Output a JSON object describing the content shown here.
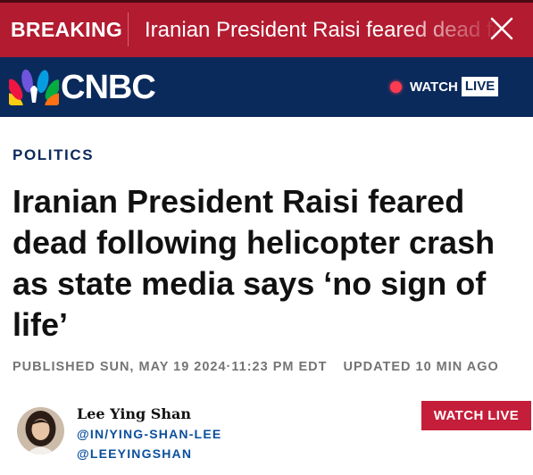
{
  "breaking": {
    "label": "BREAKING",
    "headline": "Iranian President Raisi feared dead following helicopter crash",
    "close_icon": "close-icon"
  },
  "nav": {
    "logo_text": "CNBC",
    "logo_icon": "peacock-icon",
    "watch_label": "WATCH",
    "live_label": "LIVE"
  },
  "article": {
    "section": "POLITICS",
    "headline": "Iranian President Raisi feared dead following helicopter crash as state media says ‘no sign of life’",
    "published": "PUBLISHED SUN, MAY 19 2024·11:23 PM EDT",
    "updated": "UPDATED 10 MIN AGO"
  },
  "author": {
    "name": "Lee Ying Shan",
    "handles": [
      "@IN/YING-SHAN-LEE",
      "@LEEYINGSHAN"
    ],
    "watch_live_label": "WATCH LIVE"
  },
  "colors": {
    "breaking_red": "#b31b30",
    "nav_navy": "#0b2a5c",
    "button_red": "#c41e3a",
    "link_blue": "#0b4f9c"
  }
}
